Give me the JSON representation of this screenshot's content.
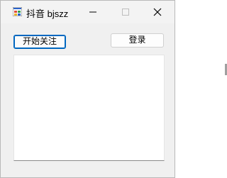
{
  "window": {
    "title": "抖音 bjszz",
    "app_icon": "windows-form-icon",
    "controls": {
      "minimize_icon": "minimize-icon",
      "maximize_icon": "maximize-icon",
      "close_icon": "close-icon"
    }
  },
  "toolbar": {
    "start_follow_label": "开始关注",
    "login_label": "登录"
  },
  "list": {
    "items": []
  },
  "colors": {
    "accent": "#0067c0",
    "window_bg": "#f0f0f0",
    "list_bg": "#ffffff"
  }
}
